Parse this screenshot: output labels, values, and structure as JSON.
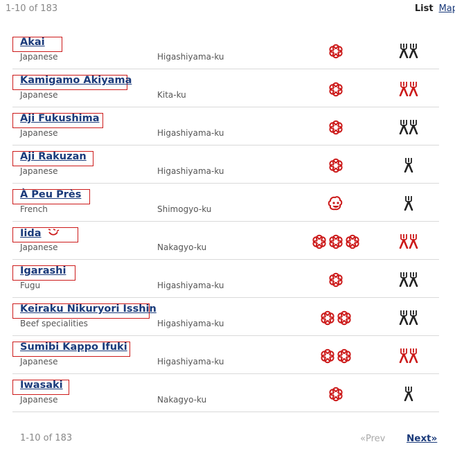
{
  "header": {
    "result_count": "1-10 of 183",
    "view_list": "List",
    "view_map": "Map"
  },
  "colors": {
    "accent": "#cc1a1a",
    "link": "#1a3a7a",
    "fork_dark": "#222222",
    "fork_red": "#cc1a1a"
  },
  "restaurants": [
    {
      "name": "Akai",
      "cuisine": "Japanese",
      "area": "Higashiyama-ku",
      "award": "1 star",
      "award_icon": "star",
      "award_count": 1,
      "comfort": 2,
      "comfort_red": false
    },
    {
      "name": "Kamigamo Akiyama",
      "cuisine": "Japanese",
      "area": "Kita-ku",
      "award": "1 star",
      "award_icon": "star",
      "award_count": 1,
      "comfort": 2,
      "comfort_red": true
    },
    {
      "name": "Aji Fukushima",
      "cuisine": "Japanese",
      "area": "Higashiyama-ku",
      "award": "1 star",
      "award_icon": "star",
      "award_count": 1,
      "comfort": 2,
      "comfort_red": false
    },
    {
      "name": "Aji Rakuzan",
      "cuisine": "Japanese",
      "area": "Higashiyama-ku",
      "award": "1 star",
      "award_icon": "star",
      "award_count": 1,
      "comfort": 1,
      "comfort_red": false
    },
    {
      "name": "À Peu Près",
      "cuisine": "French",
      "area": "Shimogyo-ku",
      "award": "Bib Gourmand",
      "award_icon": "bib",
      "award_count": 1,
      "comfort": 1,
      "comfort_red": false
    },
    {
      "name": "Iida",
      "cuisine": "Japanese",
      "area": "Nakagyo-ku",
      "award": "3 stars",
      "award_icon": "star",
      "award_count": 3,
      "comfort": 2,
      "comfort_red": true,
      "badge": "smile-icon"
    },
    {
      "name": "Igarashi",
      "cuisine": "Fugu",
      "area": "Higashiyama-ku",
      "award": "1 star",
      "award_icon": "star",
      "award_count": 1,
      "comfort": 2,
      "comfort_red": false
    },
    {
      "name": "Keiraku Nikuryori Isshin",
      "cuisine": "Beef specialities",
      "area": "Higashiyama-ku",
      "award": "2 stars",
      "award_icon": "star",
      "award_count": 2,
      "comfort": 2,
      "comfort_red": false
    },
    {
      "name": "Sumibi Kappo Ifuki",
      "cuisine": "Japanese",
      "area": "Higashiyama-ku",
      "award": "2 stars",
      "award_icon": "star",
      "award_count": 2,
      "comfort": 2,
      "comfort_red": true
    },
    {
      "name": "Iwasaki",
      "cuisine": "Japanese",
      "area": "Nakagyo-ku",
      "award": "1 star",
      "award_icon": "star",
      "award_count": 1,
      "comfort": 1,
      "comfort_red": false
    }
  ],
  "pagination": {
    "result_count": "1-10 of 183",
    "prev": "«Prev",
    "next": "Next»"
  }
}
